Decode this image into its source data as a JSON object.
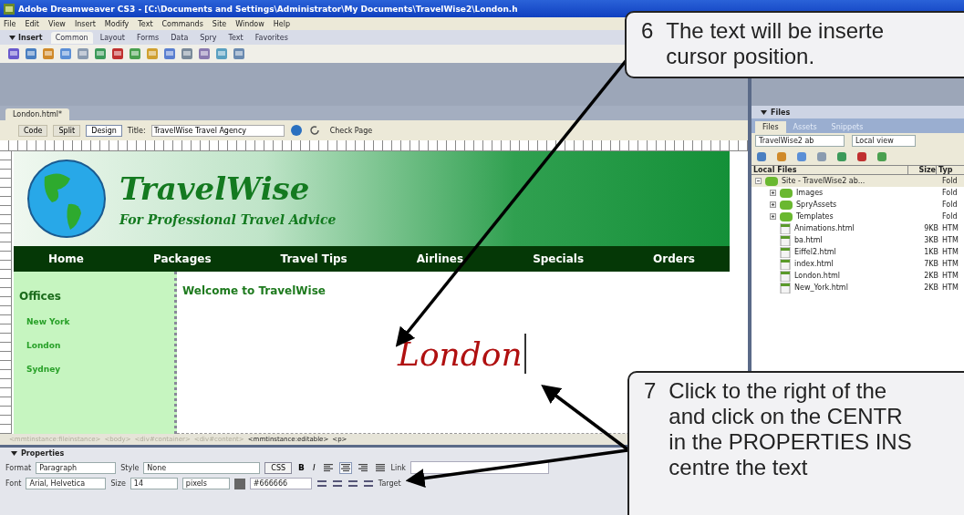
{
  "window": {
    "title": "Adobe Dreamweaver CS3 - [C:\\Documents and Settings\\Administrator\\My Documents\\TravelWise2\\London.h"
  },
  "menu": [
    "File",
    "Edit",
    "View",
    "Insert",
    "Modify",
    "Text",
    "Commands",
    "Site",
    "Window",
    "Help"
  ],
  "insert_bar": {
    "label": "Insert",
    "tabs": [
      {
        "label": "Common",
        "selected": true
      },
      {
        "label": "Layout",
        "selected": false
      },
      {
        "label": "Forms",
        "selected": false
      },
      {
        "label": "Data",
        "selected": false
      },
      {
        "label": "Spry",
        "selected": false
      },
      {
        "label": "Text",
        "selected": false
      },
      {
        "label": "Favorites",
        "selected": false
      }
    ]
  },
  "document": {
    "tab": "London.html*",
    "view_buttons": [
      {
        "label": "Code",
        "selected": false
      },
      {
        "label": "Split",
        "selected": false
      },
      {
        "label": "Design",
        "selected": true
      }
    ],
    "title_label": "Title:",
    "title_value": "TravelWise Travel Agency",
    "check_page": "Check Page"
  },
  "page": {
    "site_name": "TravelWise",
    "tagline": "For Professional Travel Advice",
    "nav": [
      "Home",
      "Packages",
      "Travel Tips",
      "Airlines",
      "Specials",
      "Orders"
    ],
    "sidebar_heading": "Offices",
    "sidebar_links": [
      "New York",
      "London",
      "Sydney"
    ],
    "heading": "Welcome to TravelWise",
    "body_text": "London"
  },
  "status_bar": {
    "tags": [
      {
        "label": "<mmtinstance:fileinstance>",
        "disabled": true
      },
      {
        "label": "<body>",
        "disabled": true
      },
      {
        "label": "<div#container>",
        "disabled": true
      },
      {
        "label": "<div#content>",
        "disabled": true
      },
      {
        "label": "<mmtinstance:editable>",
        "disabled": false
      },
      {
        "label": "<p>",
        "disabled": false
      }
    ]
  },
  "properties": {
    "title": "Properties",
    "format_label": "Format",
    "format": "Paragraph",
    "style_label": "Style",
    "style": "None",
    "css_button": "CSS",
    "bold": "B",
    "italic": "I",
    "align_buttons": [
      {
        "kind": "left",
        "selected": false
      },
      {
        "kind": "center",
        "selected": true
      },
      {
        "kind": "right",
        "selected": false
      },
      {
        "kind": "justify",
        "selected": false
      }
    ],
    "link_label": "Link",
    "font_label": "Font",
    "font": "Arial, Helvetica",
    "size_label": "Size",
    "size": "14",
    "unit": "pixels",
    "color_value": "#666666",
    "target_label": "Target"
  },
  "files_panel": {
    "title": "Files",
    "tabs": [
      {
        "label": "Files",
        "selected": true
      },
      {
        "label": "Assets",
        "selected": false
      },
      {
        "label": "Snippets",
        "selected": false
      }
    ],
    "site": "TravelWise2 ab",
    "view": "Local view",
    "columns": [
      "Local Files",
      "Size",
      "Typ"
    ],
    "tree": [
      {
        "name": "Site - TravelWise2 ab...",
        "kind": "folder",
        "type": "Fold",
        "expanded": true,
        "children": [
          {
            "name": "Images",
            "kind": "folder",
            "type": "Fold",
            "expanded": false
          },
          {
            "name": "SpryAssets",
            "kind": "folder",
            "type": "Fold",
            "expanded": false
          },
          {
            "name": "Templates",
            "kind": "folder",
            "type": "Fold",
            "expanded": false
          },
          {
            "name": "Animations.html",
            "kind": "file",
            "size": "9KB",
            "type": "HTM"
          },
          {
            "name": "ba.html",
            "kind": "file",
            "size": "3KB",
            "type": "HTM"
          },
          {
            "name": "Eiffel2.html",
            "kind": "file",
            "size": "1KB",
            "type": "HTM"
          },
          {
            "name": "index.html",
            "kind": "file",
            "size": "7KB",
            "type": "HTM"
          },
          {
            "name": "London.html",
            "kind": "file",
            "size": "2KB",
            "type": "HTM"
          },
          {
            "name": "New_York.html",
            "kind": "file",
            "size": "2KB",
            "type": "HTM"
          }
        ]
      }
    ]
  },
  "callouts": [
    {
      "number": "6",
      "lines": [
        "The text will be inserte",
        "cursor position."
      ]
    },
    {
      "number": "7",
      "lines": [
        "Click to the right of the",
        "and click on the CENTR",
        "in the PROPERTIES INS",
        "centre the text"
      ]
    }
  ]
}
